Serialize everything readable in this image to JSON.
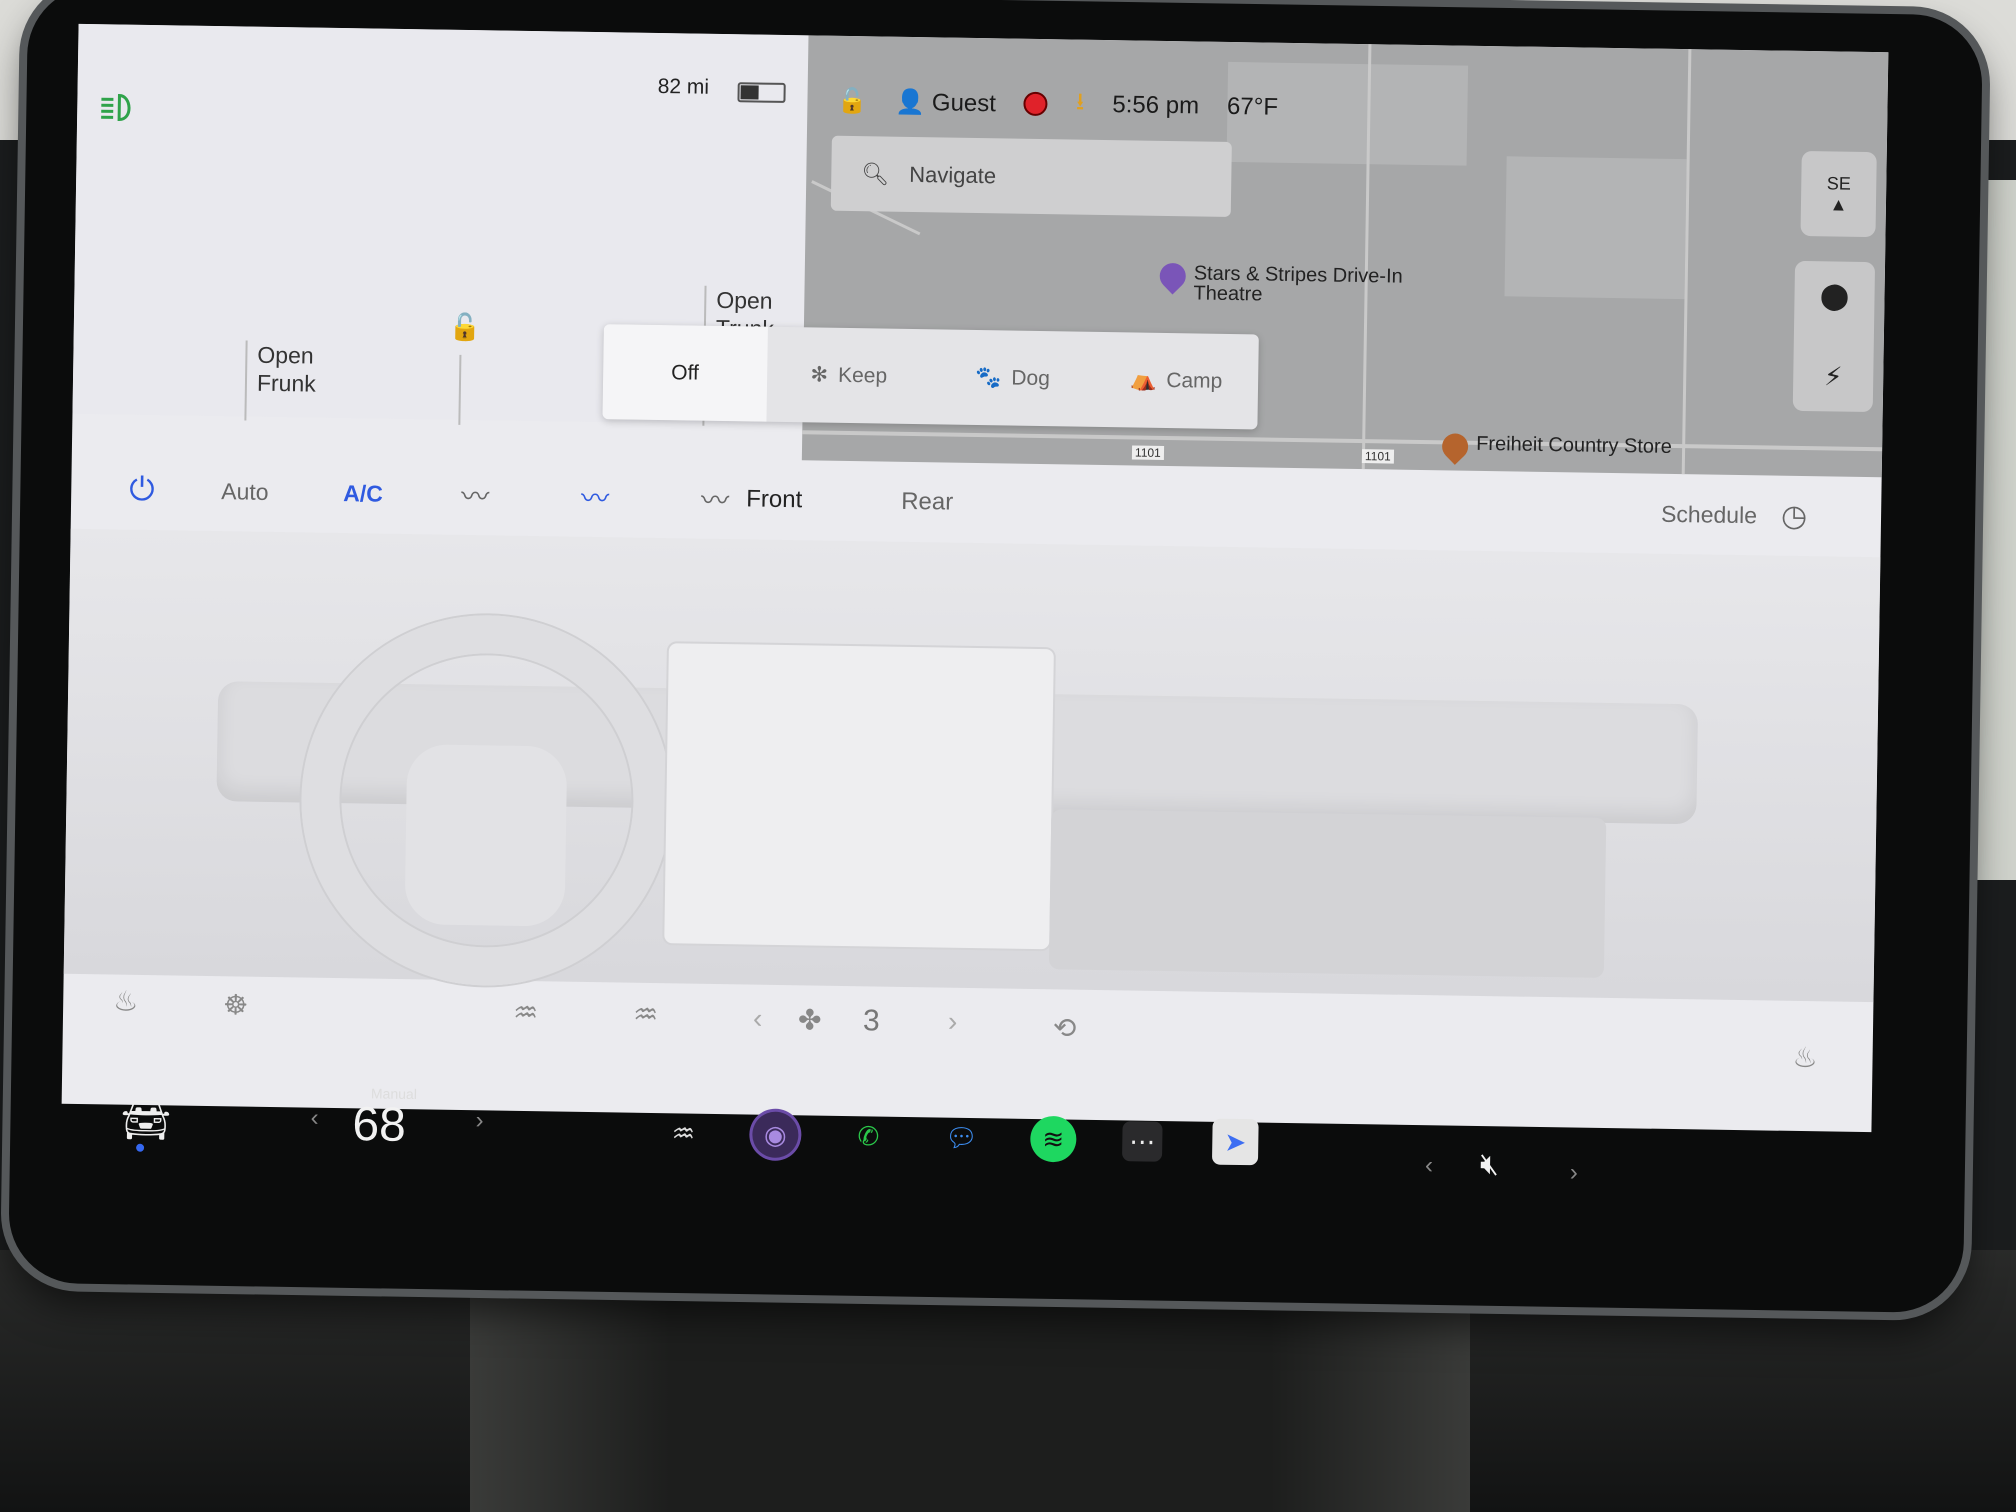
{
  "status_bar": {
    "range": "82 mi",
    "profile": "Guest",
    "time": "5:56 pm",
    "outside_temp": "67°F"
  },
  "car_panel": {
    "frunk_label_1": "Open",
    "frunk_label_2": "Frunk",
    "trunk_label_1": "Open",
    "trunk_label_2": "Trunk"
  },
  "map": {
    "search_placeholder": "Navigate",
    "compass_heading": "SE",
    "pois": [
      {
        "name_1": "Stars & Stripes Drive-In",
        "name_2": "Theatre",
        "color": "#7a55b8"
      },
      {
        "name_1": "Freiheit Country Store",
        "name_2": "",
        "color": "#b5642d"
      }
    ],
    "road_labels": [
      "1101",
      "1101"
    ]
  },
  "climate_modes": {
    "selected": "Off",
    "options": [
      "Off",
      "Keep",
      "Dog",
      "Camp"
    ]
  },
  "climate_bar": {
    "auto": "Auto",
    "ac": "A/C",
    "front": "Front",
    "rear": "Rear",
    "schedule": "Schedule",
    "active_color": "#2f5ae0"
  },
  "fan": {
    "level": "3"
  },
  "dock": {
    "temp_mode": "Manual",
    "temperature": "68",
    "apps": [
      {
        "name": "defrost-icon",
        "color": "#dddddd"
      },
      {
        "name": "camera-icon",
        "color": "#6b4ca8"
      },
      {
        "name": "phone-icon",
        "color": "#2ac84a"
      },
      {
        "name": "messages-icon",
        "color": "#3d8ef2"
      },
      {
        "name": "spotify-icon",
        "color": "#1ed760"
      },
      {
        "name": "more-apps-icon",
        "color": "#dddddd"
      },
      {
        "name": "navigation-app-icon",
        "color": "#3d6ef2"
      }
    ]
  }
}
